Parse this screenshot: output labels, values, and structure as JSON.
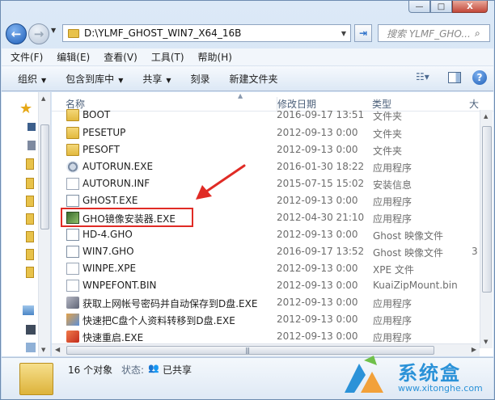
{
  "window": {
    "caption": {
      "minimize": "—",
      "maximize": "□",
      "close": "X"
    }
  },
  "address": {
    "path": "D:\\YLMF_GHOST_WIN7_X64_16B",
    "search_placeholder": "搜索 YLMF_GHO..."
  },
  "menu": [
    "文件(F)",
    "编辑(E)",
    "查看(V)",
    "工具(T)",
    "帮助(H)"
  ],
  "toolbar": {
    "organize": "组织",
    "include_library": "包含到库中",
    "share": "共享",
    "burn": "刻录",
    "new_folder": "新建文件夹"
  },
  "columns": {
    "name": "名称",
    "date": "修改日期",
    "type": "类型",
    "size": "大"
  },
  "files": [
    {
      "name": "BOOT",
      "date": "2016-09-17 13:51",
      "type": "文件夹",
      "size": "",
      "icon": "folder-icon"
    },
    {
      "name": "PESETUP",
      "date": "2012-09-13 0:00",
      "type": "文件夹",
      "size": "",
      "icon": "folder-icon"
    },
    {
      "name": "PESOFT",
      "date": "2012-09-13 0:00",
      "type": "文件夹",
      "size": "",
      "icon": "folder-icon"
    },
    {
      "name": "AUTORUN.EXE",
      "date": "2016-01-30 18:22",
      "type": "应用程序",
      "size": "",
      "icon": "setup-icon"
    },
    {
      "name": "AUTORUN.INF",
      "date": "2015-07-15 15:02",
      "type": "安装信息",
      "size": "",
      "icon": "inf-icon"
    },
    {
      "name": "GHOST.EXE",
      "date": "2012-09-13 0:00",
      "type": "应用程序",
      "size": "",
      "icon": "ghost-icon"
    },
    {
      "name": "GHO镜像安装器.EXE",
      "date": "2012-04-30 21:10",
      "type": "应用程序",
      "size": "",
      "icon": "gho-installer-icon"
    },
    {
      "name": "HD-4.GHO",
      "date": "2012-09-13 0:00",
      "type": "Ghost 映像文件",
      "size": "",
      "icon": "gho-file-icon"
    },
    {
      "name": "WIN7.GHO",
      "date": "2016-09-17 13:52",
      "type": "Ghost 映像文件",
      "size": "3",
      "icon": "gho-file-icon"
    },
    {
      "name": "WINPE.XPE",
      "date": "2012-09-13 0:00",
      "type": "XPE 文件",
      "size": "",
      "icon": "document-icon"
    },
    {
      "name": "WNPEFONT.BIN",
      "date": "2012-09-13 0:00",
      "type": "KuaiZipMount.bin",
      "size": "",
      "icon": "document-icon"
    },
    {
      "name": "获取上网帐号密码并自动保存到D盘.EXE",
      "date": "2012-09-13 0:00",
      "type": "应用程序",
      "size": "",
      "icon": "app-icon"
    },
    {
      "name": "快速把C盘个人资料转移到D盘.EXE",
      "date": "2012-09-13 0:00",
      "type": "应用程序",
      "size": "",
      "icon": "app-icon"
    },
    {
      "name": "快速重启.EXE",
      "date": "2012-09-13 0:00",
      "type": "应用程序",
      "size": "",
      "icon": "restart-icon"
    }
  ],
  "details": {
    "count": "16 个对象",
    "state_label": "状态:",
    "share_state": "已共享"
  },
  "watermark": {
    "brand": "系统盒",
    "url": "www.xitonghe.com"
  },
  "colors": {
    "highlight": "#e02b25",
    "accent": "#2b92d8"
  }
}
